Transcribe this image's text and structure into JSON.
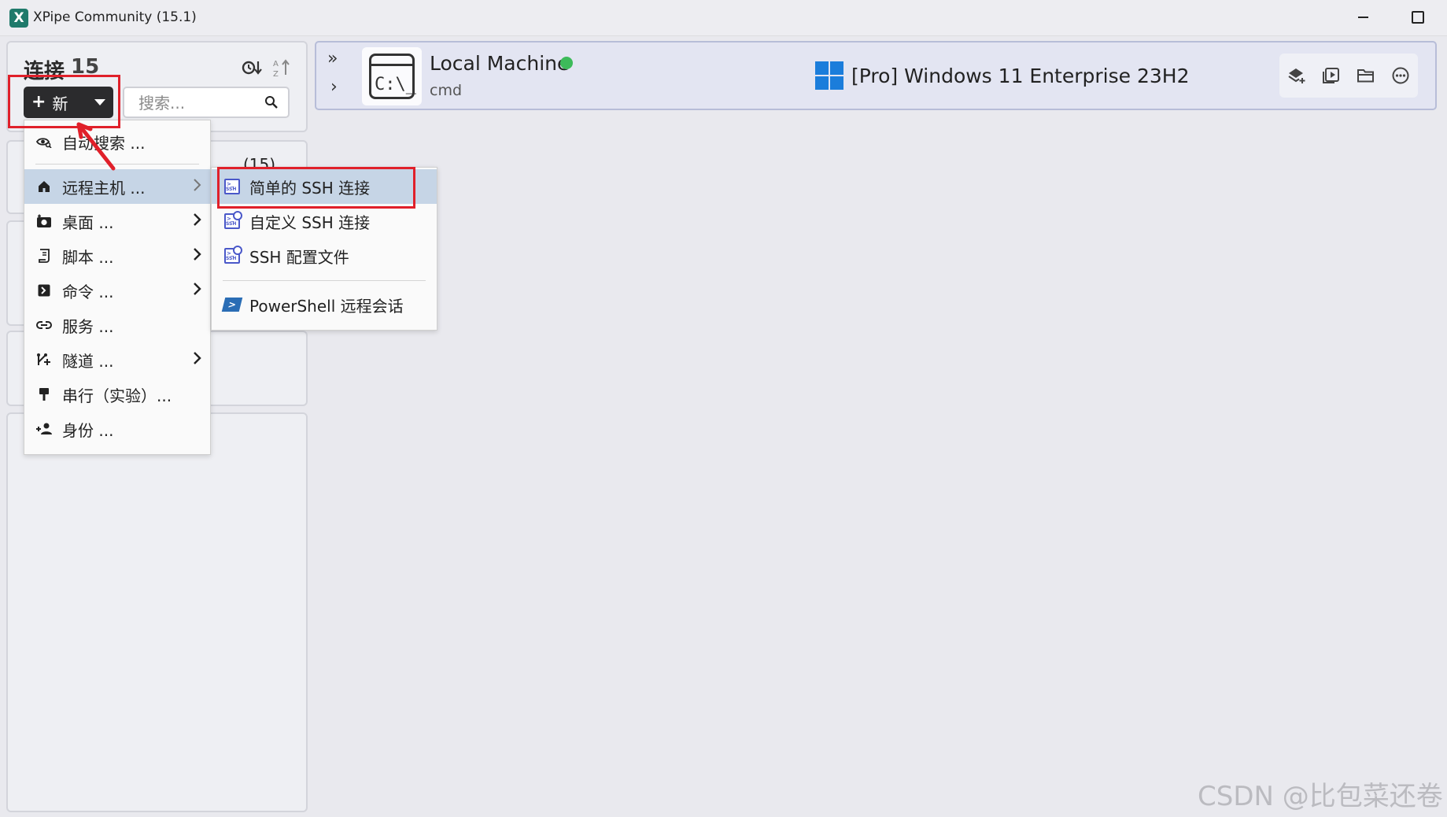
{
  "window": {
    "title": "XPipe Community (15.1)"
  },
  "sidebar": {
    "title": "连接",
    "count": "15",
    "new_button_label": "新",
    "search_placeholder": "搜索...",
    "category_count": "(15)"
  },
  "new_menu": {
    "items": [
      {
        "label": "自动搜索 ...",
        "icon": "eye-search-icon",
        "has_submenu": false
      },
      {
        "label": "远程主机 ...",
        "icon": "home-icon",
        "has_submenu": true,
        "active": true
      },
      {
        "label": "桌面 ...",
        "icon": "camera-icon",
        "has_submenu": true
      },
      {
        "label": "脚本 ...",
        "icon": "script-icon",
        "has_submenu": true
      },
      {
        "label": "命令 ...",
        "icon": "terminal-icon",
        "has_submenu": true
      },
      {
        "label": "服务 ...",
        "icon": "link-icon",
        "has_submenu": false
      },
      {
        "label": "隧道 ...",
        "icon": "tunnel-icon",
        "has_submenu": true
      },
      {
        "label": "串行（实验）...",
        "icon": "plug-icon",
        "has_submenu": false
      },
      {
        "label": "身份 ...",
        "icon": "users-icon",
        "has_submenu": false
      }
    ]
  },
  "remote_submenu": {
    "items": [
      {
        "label": "简单的 SSH 连接",
        "icon": "ssh-icon",
        "active": true
      },
      {
        "label": "自定义 SSH 连接",
        "icon": "ssh-custom-icon"
      },
      {
        "label": "SSH 配置文件",
        "icon": "ssh-config-icon"
      },
      {
        "label": "PowerShell 远程会话",
        "icon": "powershell-icon"
      }
    ]
  },
  "main": {
    "machine_name": "Local Machine",
    "shell": "cmd",
    "terminal_glyph": "C:\\_",
    "status": "online",
    "os_name": "[Pro] Windows 11 Enterprise 23H2",
    "actions": [
      "add-layer-icon",
      "play-icon",
      "folder-icon",
      "more-icon"
    ]
  },
  "watermark": "CSDN @比包菜还卷",
  "colors": {
    "accent_highlight": "#e0202a",
    "status_online": "#3dbb5a",
    "menu_active": "#c6d5e6",
    "windows_blue": "#1b7ddb"
  }
}
